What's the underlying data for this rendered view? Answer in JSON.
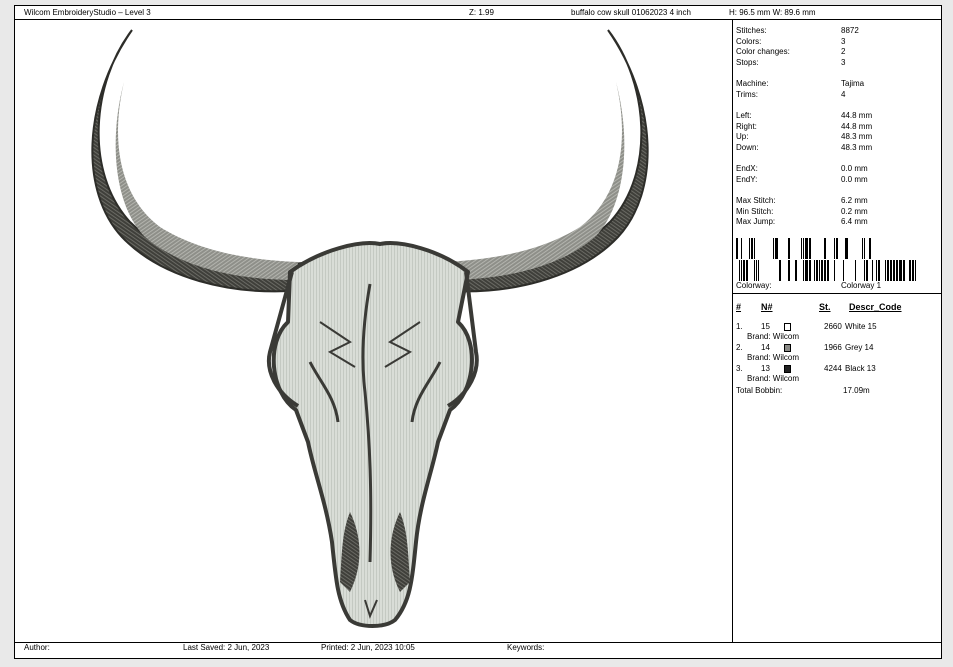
{
  "header": {
    "title": "Wilcom EmbroideryStudio – Level 3",
    "zoom": "Z: 1.99",
    "design_name": "buffalo cow skull 01062023 4 inch",
    "size": "H: 96.5 mm   W: 89.6 mm"
  },
  "stats": [
    {
      "label": "Stitches:",
      "value": "8872"
    },
    {
      "label": "Colors:",
      "value": "3"
    },
    {
      "label": "Color changes:",
      "value": "2"
    },
    {
      "label": "Stops:",
      "value": "3"
    },
    {
      "label": "Machine:",
      "value": "Tajima"
    },
    {
      "label": "Trims:",
      "value": "4"
    },
    {
      "label": "Left:",
      "value": "44.8 mm"
    },
    {
      "label": "Right:",
      "value": "44.8 mm"
    },
    {
      "label": "Up:",
      "value": "48.3 mm"
    },
    {
      "label": "Down:",
      "value": "48.3 mm"
    },
    {
      "label": "EndX:",
      "value": "0.0 mm"
    },
    {
      "label": "EndY:",
      "value": "0.0 mm"
    },
    {
      "label": "Max Stitch:",
      "value": "6.2 mm"
    },
    {
      "label": "Min Stitch:",
      "value": "0.2 mm"
    },
    {
      "label": "Max Jump:",
      "value": "6.4 mm"
    }
  ],
  "colorway": {
    "label": "Colorway:",
    "value": "Colorway 1"
  },
  "table": {
    "headers": {
      "index": "#",
      "needle": "N#",
      "stitches": "St.",
      "description": "Descr_Code"
    },
    "rows": [
      {
        "index": "1.",
        "needle": "15",
        "color": "#ffffff",
        "stitches": "2660",
        "description": "White 15",
        "brand": "Brand: Wilcom"
      },
      {
        "index": "2.",
        "needle": "14",
        "color": "#8a8a86",
        "stitches": "1966",
        "description": "Grey 14",
        "brand": "Brand: Wilcom"
      },
      {
        "index": "3.",
        "needle": "13",
        "color": "#222222",
        "stitches": "4244",
        "description": "Black 13",
        "brand": "Brand: Wilcom"
      }
    ],
    "total_label": "Total Bobbin:",
    "total_value": "17.09m"
  },
  "footer": {
    "author_label": "Author:",
    "author_value": "",
    "last_saved": "Last Saved:  2 Jun, 2023",
    "printed": "Printed:  2 Jun, 2023 10:05",
    "keywords_label": "Keywords:"
  },
  "colors": {
    "thread_dark": "#4a4a44",
    "thread_grey": "#8c8c86",
    "thread_light": "#d8dcd6"
  }
}
